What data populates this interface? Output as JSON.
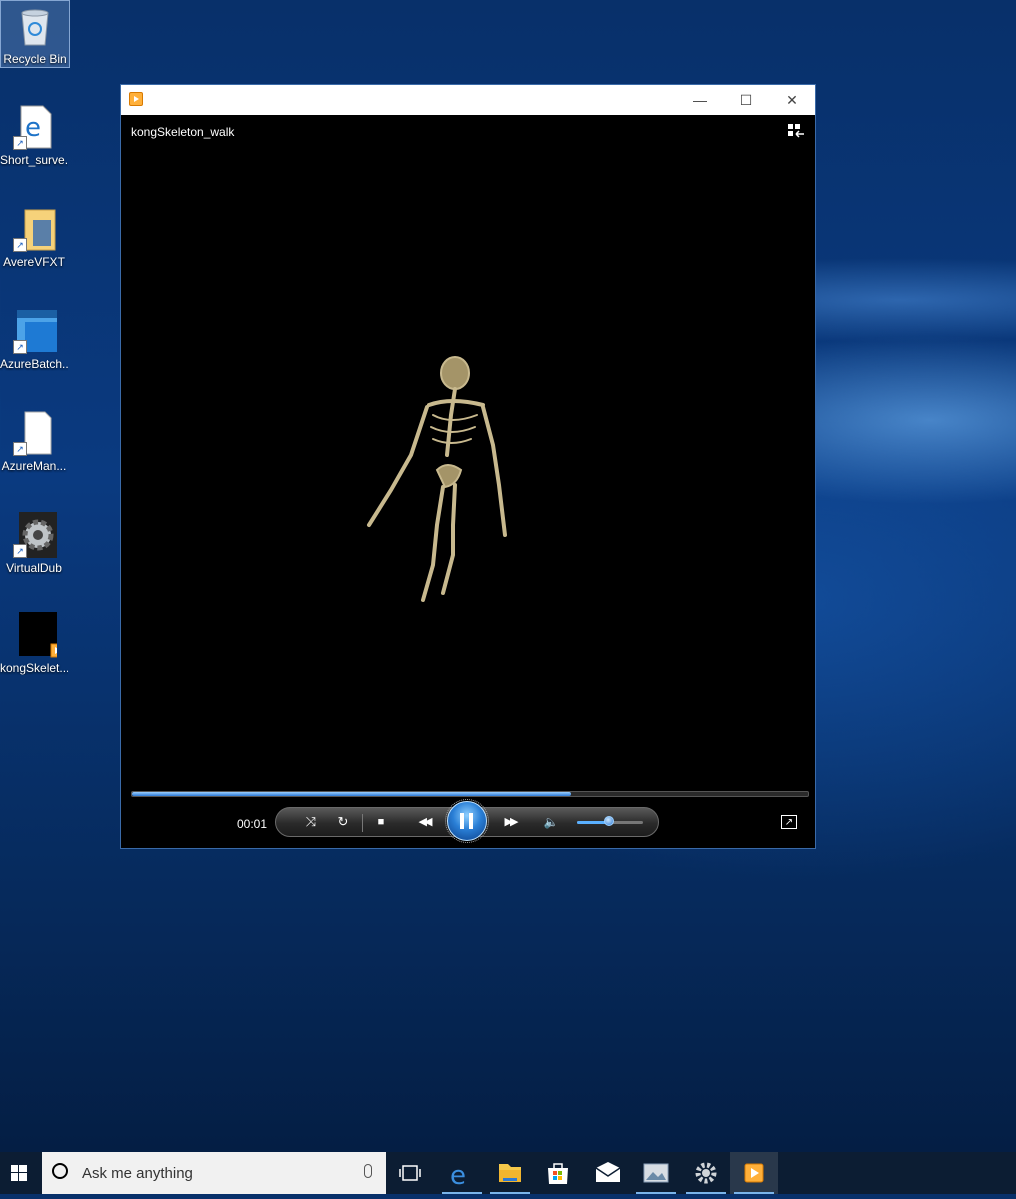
{
  "desktop": {
    "icons": [
      {
        "label": "Recycle Bin",
        "icon": "recycle-bin-icon"
      },
      {
        "label": "Short_surve...",
        "icon": "edge-shortcut-icon"
      },
      {
        "label": "AvereVFXT",
        "icon": "folder-shortcut-icon"
      },
      {
        "label": "AzureBatch...",
        "icon": "app-shortcut-icon"
      },
      {
        "label": "AzureMan...",
        "icon": "file-shortcut-icon"
      },
      {
        "label": "VirtualDub",
        "icon": "gear-shortcut-icon"
      },
      {
        "label": "kongSkelet...",
        "icon": "video-file-icon"
      }
    ]
  },
  "player": {
    "window_buttons": {
      "minimize": "—",
      "maximize": "☐",
      "close": "✕"
    },
    "video_title": "kongSkeleton_walk",
    "current_time": "00:01",
    "seek_progress": 0.65,
    "volume_level": 0.5,
    "controls": {
      "shuffle": "⤨",
      "repeat": "↻",
      "stop": "■",
      "previous": "◀◀",
      "next": "▶▶",
      "volume": "🔈"
    }
  },
  "taskbar": {
    "search_placeholder": "Ask me anything",
    "apps": [
      "task-view-icon",
      "edge-icon",
      "file-explorer-icon",
      "store-icon",
      "mail-icon",
      "photos-icon",
      "settings-gear-icon",
      "media-player-icon"
    ]
  }
}
